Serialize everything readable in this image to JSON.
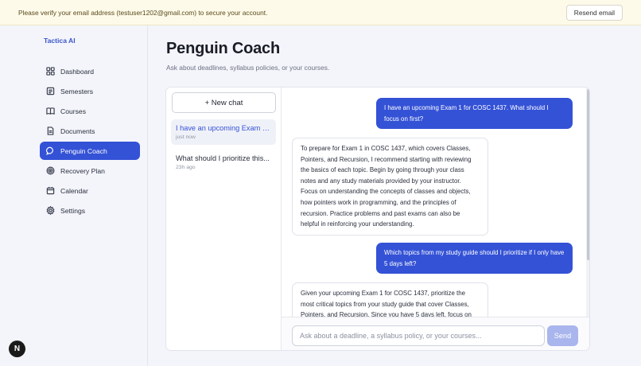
{
  "banner": {
    "message": "Please verify your email address (testuser1202@gmail.com) to secure your account.",
    "button_label": "Resend email"
  },
  "sidebar": {
    "brand": "Tactica AI",
    "items": [
      {
        "label": "Dashboard",
        "icon": "grid-icon",
        "active": false
      },
      {
        "label": "Semesters",
        "icon": "calendar-list-icon",
        "active": false
      },
      {
        "label": "Courses",
        "icon": "book-icon",
        "active": false
      },
      {
        "label": "Documents",
        "icon": "document-icon",
        "active": false
      },
      {
        "label": "Penguin Coach",
        "icon": "chat-bubble-icon",
        "active": true
      },
      {
        "label": "Recovery Plan",
        "icon": "target-icon",
        "active": false
      },
      {
        "label": "Calendar",
        "icon": "calendar-icon",
        "active": false
      },
      {
        "label": "Settings",
        "icon": "gear-icon",
        "active": false
      }
    ]
  },
  "page": {
    "title": "Penguin Coach",
    "subtitle": "Ask about deadlines, syllabus policies, or your courses."
  },
  "threads": {
    "new_chat_label": "+ New chat",
    "items": [
      {
        "title": "I have an upcoming Exam 1 ...",
        "time": "just now",
        "active": true
      },
      {
        "title": "What should I prioritize this...",
        "time": "23h ago",
        "active": false
      }
    ]
  },
  "messages": [
    {
      "role": "user",
      "text": "I have an upcoming Exam 1 for COSC 1437. What should I focus on first?"
    },
    {
      "role": "assistant",
      "text": "To prepare for Exam 1 in COSC 1437, which covers Classes, Pointers, and Recursion, I recommend starting with reviewing the basics of each topic. Begin by going through your class notes and any study materials provided by your instructor. Focus on understanding the concepts of classes and objects, how pointers work in programming, and the principles of recursion. Practice problems and past exams can also be helpful in reinforcing your understanding."
    },
    {
      "role": "user",
      "text": "Which topics from my study guide should I prioritize if I only have 5 days left?"
    },
    {
      "role": "assistant",
      "text": "Given your upcoming Exam 1 for COSC 1437, prioritize the most critical topics from your study guide that cover Classes, Pointers, and Recursion. Since you have 5 days left, focus on"
    }
  ],
  "composer": {
    "placeholder": "Ask about a deadline, a syllabus policy, or your courses...",
    "send_label": "Send"
  },
  "colors": {
    "accent": "#3452d6",
    "send_disabled": "#a9b5ed",
    "banner_bg": "#fdfae9"
  }
}
